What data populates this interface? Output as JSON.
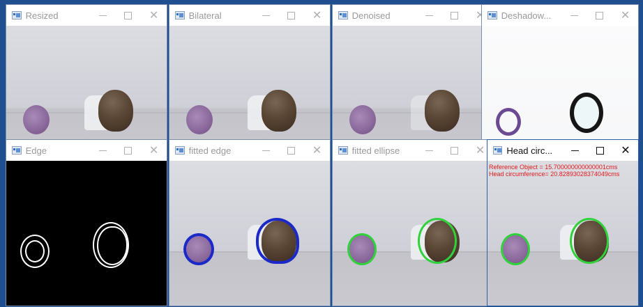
{
  "windows": [
    {
      "title": "Resized"
    },
    {
      "title": "Bilateral"
    },
    {
      "title": "Denoised"
    },
    {
      "title": "Deshadow..."
    },
    {
      "title": "Edge"
    },
    {
      "title": "fitted edge"
    },
    {
      "title": "fitted ellipse"
    },
    {
      "title": "Head circ..."
    }
  ],
  "head_circ": {
    "reference_line": "Reference Object = 15.700000000000001cms",
    "circumference_line": "Head circumference= 20.82893028374049cms"
  },
  "icons": {
    "minimize": "minimize-icon",
    "maximize": "maximize-icon",
    "close": "close-icon"
  },
  "colors": {
    "edge_overlay": "#1b29c8",
    "ellipse_overlay": "#2fd23a",
    "annotation_text": "#e01a1a"
  }
}
